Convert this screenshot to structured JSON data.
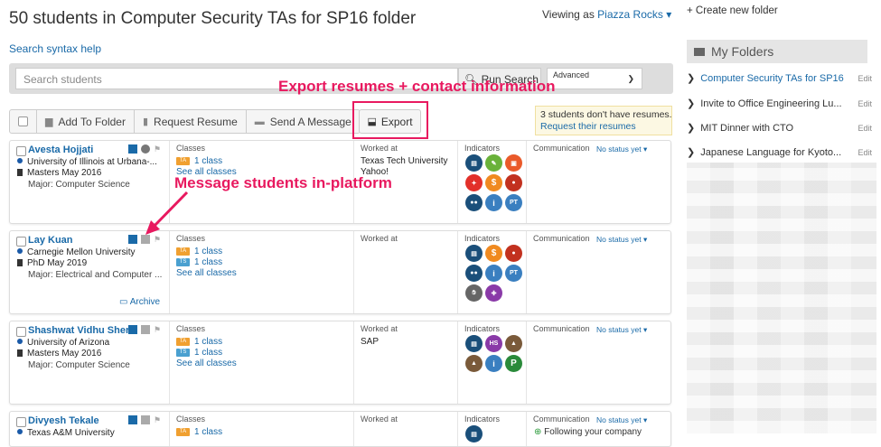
{
  "header": {
    "title": "50 students in Computer Security TAs for SP16 folder",
    "viewing_prefix": "Viewing as",
    "viewing_user": "Piazza Rocks",
    "syntax_help": "Search syntax help"
  },
  "search": {
    "placeholder": "Search students",
    "run_label": "Run Search",
    "advanced_label": "Advanced"
  },
  "callouts": {
    "export": "Export resumes + contact information",
    "message": "Message students in-platform"
  },
  "toolbar": {
    "add_to_folder": "Add To Folder",
    "request_resume": "Request Resume",
    "send_message": "Send A Message",
    "export": "Export"
  },
  "warning": {
    "line1": "3 students don't have resumes.",
    "link": "Request their resumes"
  },
  "headers": {
    "classes": "Classes",
    "worked_at": "Worked at",
    "indicators": "Indicators",
    "communication": "Communication",
    "status": "No status yet",
    "see_all": "See all classes",
    "one_class": "1 class",
    "archive": "Archive",
    "ta_tag": "TA",
    "ts_tag": "TS",
    "following": "Following your company"
  },
  "students": [
    {
      "name": "Avesta Hojjati",
      "university": "University of Illinois at Urbana-...",
      "degree": "Masters May 2016",
      "major": "Major: Computer Science",
      "worked_at": [
        "Texas Tech University",
        "Yahoo!"
      ]
    },
    {
      "name": "Lay Kuan",
      "university": "Carnegie Mellon University",
      "degree": "PhD May 2019",
      "major": "Major: Electrical and Computer ...",
      "worked_at": []
    },
    {
      "name": "Shashwat Vidhu Sher",
      "university": "University of Arizona",
      "degree": "Masters May 2016",
      "major": "Major: Computer Science",
      "worked_at": [
        "SAP"
      ]
    },
    {
      "name": "Divyesh Tekale",
      "university": "Texas A&M University",
      "degree": "",
      "major": "",
      "worked_at": []
    }
  ],
  "indicator_labels": {
    "hs": "HS",
    "pt": "PT",
    "p": "P",
    "dollar": "$",
    "info": "i"
  },
  "sidebar": {
    "create_folder": "Create new folder",
    "my_folders": "My Folders",
    "edit": "Edit",
    "folders": [
      "Computer Security TAs for SP16",
      "Invite to Office Engineering Lu...",
      "MIT Dinner with CTO",
      "Japanese Language for Kyoto..."
    ]
  },
  "colors": {
    "accent": "#e8195f",
    "link": "#1a6aa8"
  }
}
